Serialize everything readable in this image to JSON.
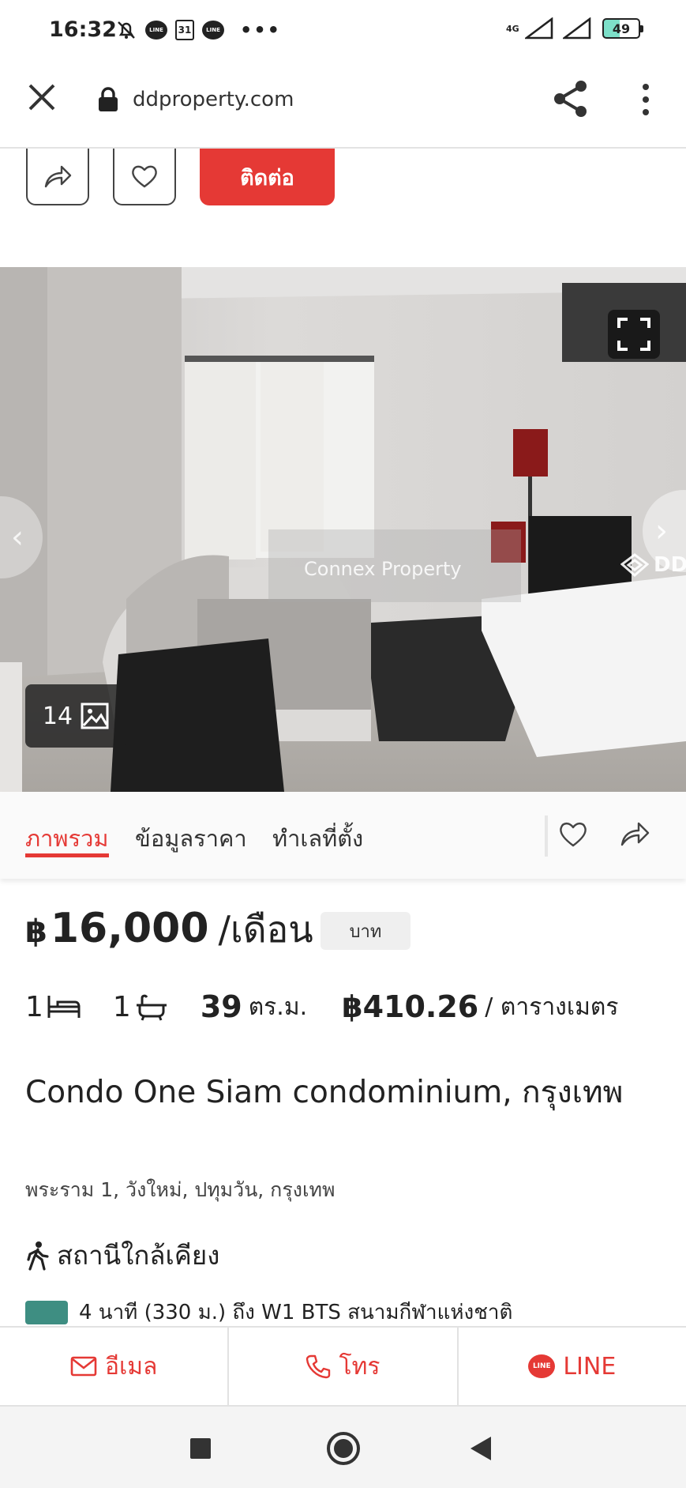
{
  "status_bar": {
    "time": "16:32",
    "calendar_day": "31",
    "line_label": "LINE",
    "network": "4G",
    "battery": "49"
  },
  "browser": {
    "url": "ddproperty.com"
  },
  "actions": {
    "contact_label": "ติดต่อ"
  },
  "gallery": {
    "photo_count": "14",
    "watermark": "Connex Property",
    "logo_text": "DDp"
  },
  "tabs": [
    {
      "label": "ภาพรวม",
      "active": true
    },
    {
      "label": "ข้อมูลราคา",
      "active": false
    },
    {
      "label": "ทำเลที่ตั้ง",
      "active": false
    }
  ],
  "listing": {
    "currency_symbol": "฿",
    "price": "16,000",
    "price_unit": "/เดือน",
    "currency_badge": "บาท",
    "bedrooms": "1",
    "bathrooms": "1",
    "area_value": "39",
    "area_unit": "ตร.ม.",
    "price_per_area": "฿410.26",
    "price_per_area_unit": "/ ตารางเมตร",
    "title": "Condo One Siam condominium, กรุงเทพ",
    "address": "พระราม 1, วังใหม่, ปทุมวัน, กรุงเทพ",
    "nearby_heading": "สถานีใกล้เคียง",
    "station": "4 นาที (330 ม.) ถึง W1 BTS สนามกีฬาแห่งชาติ",
    "station_color": "#3e8e82"
  },
  "contact_bar": {
    "email_label": "อีเมล",
    "call_label": "โทร",
    "line_label": "LINE",
    "line_icon_label": "LINE"
  },
  "colors": {
    "accent": "#e53935"
  }
}
